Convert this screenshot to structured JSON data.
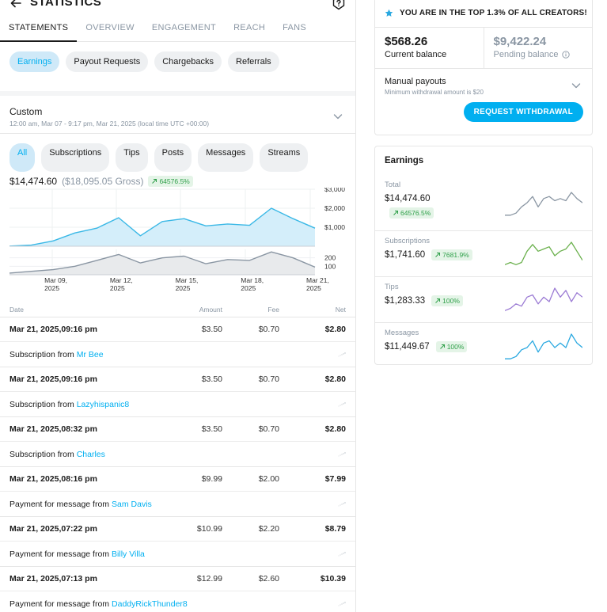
{
  "header": {
    "title": "STATISTICS"
  },
  "tabs": [
    {
      "label": "STATEMENTS",
      "active": true
    },
    {
      "label": "OVERVIEW",
      "active": false
    },
    {
      "label": "ENGAGEMENT",
      "active": false
    },
    {
      "label": "REACH",
      "active": false
    },
    {
      "label": "FANS",
      "active": false
    }
  ],
  "statement_filters": [
    {
      "label": "Earnings",
      "active": true
    },
    {
      "label": "Payout Requests",
      "active": false
    },
    {
      "label": "Chargebacks",
      "active": false
    },
    {
      "label": "Referrals",
      "active": false
    }
  ],
  "range": {
    "title": "Custom",
    "subtitle": "12:00 am, Mar 07 - 9:17 pm, Mar 21, 2025 (local time UTC +00:00)"
  },
  "type_filters": [
    {
      "label": "All",
      "active": true
    },
    {
      "label": "Subscriptions",
      "active": false
    },
    {
      "label": "Tips",
      "active": false
    },
    {
      "label": "Posts",
      "active": false
    },
    {
      "label": "Messages",
      "active": false
    },
    {
      "label": "Streams",
      "active": false
    }
  ],
  "summary": {
    "net": "$14,474.60",
    "gross": "($18,095.05 Gross)",
    "growth": "64576.5%"
  },
  "chart_data": {
    "type": "line",
    "x": [
      "Mar 07",
      "Mar 08",
      "Mar 09",
      "Mar 10",
      "Mar 11",
      "Mar 12",
      "Mar 13",
      "Mar 14",
      "Mar 15",
      "Mar 16",
      "Mar 17",
      "Mar 18",
      "Mar 19",
      "Mar 20",
      "Mar 21"
    ],
    "x_tick_labels": [
      {
        "line1": "Mar 09,",
        "line2": "2025",
        "index": 2
      },
      {
        "line1": "Mar 12,",
        "line2": "2025",
        "index": 5
      },
      {
        "line1": "Mar 15,",
        "line2": "2025",
        "index": 8
      },
      {
        "line1": "Mar 18,",
        "line2": "2025",
        "index": 11
      },
      {
        "line1": "Mar 21,",
        "line2": "2025",
        "index": 14
      }
    ],
    "panels": [
      {
        "name": "earnings",
        "color": "#3ab8e6",
        "fill": "#d4eefa",
        "ylim": [
          0,
          3000
        ],
        "y_ticks": [
          "$3,000",
          "$2,000",
          "$1,000"
        ],
        "y_tick_values": [
          3000,
          2000,
          1000
        ],
        "values": [
          10,
          60,
          280,
          700,
          950,
          1500,
          550,
          1300,
          1450,
          1070,
          1170,
          1100,
          2000,
          1450,
          950
        ]
      },
      {
        "name": "transactions",
        "color": "#8a96a3",
        "fill": "#e8eaec",
        "ylim": [
          0,
          300
        ],
        "y_ticks": [
          "200",
          "100"
        ],
        "y_tick_values": [
          200,
          100
        ],
        "values": [
          20,
          40,
          60,
          100,
          170,
          240,
          140,
          200,
          220,
          130,
          180,
          170,
          270,
          200,
          90
        ]
      }
    ],
    "grid": true
  },
  "table": {
    "headers": {
      "date": "Date",
      "amount": "Amount",
      "fee": "Fee",
      "net": "Net"
    },
    "rows": [
      {
        "date": "Mar 21, 2025,09:16 pm",
        "amount": "$3.50",
        "fee": "$0.70",
        "net": "$2.80",
        "desc": "Subscription from",
        "who": "Mr Bee"
      },
      {
        "date": "Mar 21, 2025,09:16 pm",
        "amount": "$3.50",
        "fee": "$0.70",
        "net": "$2.80",
        "desc": "Subscription from",
        "who": "Lazyhispanic8"
      },
      {
        "date": "Mar 21, 2025,08:32 pm",
        "amount": "$3.50",
        "fee": "$0.70",
        "net": "$2.80",
        "desc": "Subscription from",
        "who": "Charles"
      },
      {
        "date": "Mar 21, 2025,08:16 pm",
        "amount": "$9.99",
        "fee": "$2.00",
        "net": "$7.99",
        "desc": "Payment for message from",
        "who": "Sam Davis"
      },
      {
        "date": "Mar 21, 2025,07:22 pm",
        "amount": "$10.99",
        "fee": "$2.20",
        "net": "$8.79",
        "desc": "Payment for message from",
        "who": "Billy Villa"
      },
      {
        "date": "Mar 21, 2025,07:13 pm",
        "amount": "$12.99",
        "fee": "$2.60",
        "net": "$10.39",
        "desc": "Payment for message from",
        "who": "DaddyRickThunder8"
      }
    ]
  },
  "top_card": {
    "banner": "YOU ARE IN THE TOP 1.3% OF ALL CREATORS!",
    "current_balance": "$568.26",
    "current_label": "Current balance",
    "pending_balance": "$9,422.24",
    "pending_label": "Pending balance",
    "payout_title": "Manual payouts",
    "payout_sub": "Minimum withdrawal amount is $20",
    "withdraw_label": "REQUEST WITHDRAWAL"
  },
  "earnings_card": {
    "title": "Earnings",
    "items": [
      {
        "label": "Total",
        "value": "$14,474.60",
        "growth": "64576.5%",
        "color": "#8a96a3",
        "spark": [
          2,
          2,
          3,
          6,
          8,
          11,
          6,
          10,
          11,
          9,
          10,
          9,
          13,
          10,
          8
        ]
      },
      {
        "label": "Subscriptions",
        "value": "$1,741.60",
        "growth": "7681.9%",
        "color": "#6ab04c",
        "spark": [
          2,
          3,
          2,
          3,
          8,
          11,
          8,
          9,
          10,
          6,
          8,
          9,
          12,
          8,
          4
        ]
      },
      {
        "label": "Tips",
        "value": "$1,283.33",
        "growth": "100%",
        "color": "#9b7bd4",
        "spark": [
          2,
          3,
          5,
          4,
          8,
          9,
          5,
          8,
          6,
          12,
          8,
          11,
          6,
          10,
          8
        ]
      },
      {
        "label": "Messages",
        "value": "$11,449.67",
        "growth": "100%",
        "color": "#29a8e0",
        "spark": [
          1,
          1,
          2,
          5,
          6,
          9,
          4,
          8,
          9,
          6,
          8,
          6,
          12,
          8,
          6
        ]
      }
    ]
  }
}
